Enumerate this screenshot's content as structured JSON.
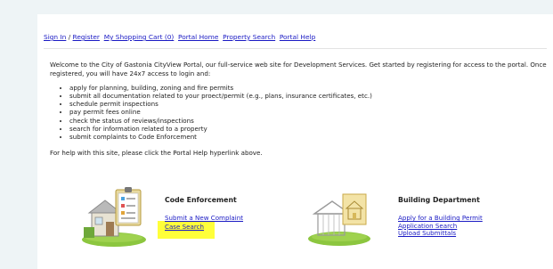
{
  "nav": {
    "sign_in": "Sign In",
    "slash": " / ",
    "register": "Register",
    "cart": "My Shopping Cart (0)",
    "portal_home": "Portal Home",
    "property_search": "Property Search",
    "portal_help": "Portal Help"
  },
  "intro": {
    "welcome": "Welcome to the City of Gastonia CityView Portal, our full-service web site for Development Services. Get started by registering for access to the portal. Once registered, you will have 24x7 access to login and:",
    "bullets": [
      "apply for planning, building, zoning and fire permits",
      "submit all documentation related to your proect/permit (e.g., plans, insurance certificates, etc.)",
      "schedule permit inspections",
      "pay permit fees online",
      "check the status of reviews/inspections",
      "search for information related to a property",
      "submit complaints to Code Enforcement"
    ],
    "help": "For help with this site, please click the Portal Help hyperlink above."
  },
  "code_enforcement": {
    "title": "Code Enforcement",
    "links": [
      "Submit a New Complaint",
      "Case Search"
    ]
  },
  "building": {
    "title": "Building Department",
    "links": [
      "Apply for a Building Permit",
      "Application Search",
      "Upload Submittals"
    ]
  },
  "colors": {
    "link": "#1a1ac4",
    "highlight": "#ffff3a",
    "grass": "#8cc63f"
  },
  "icons": {
    "code_enforcement": "house-clipboard-icon",
    "building": "house-blueprint-icon"
  }
}
